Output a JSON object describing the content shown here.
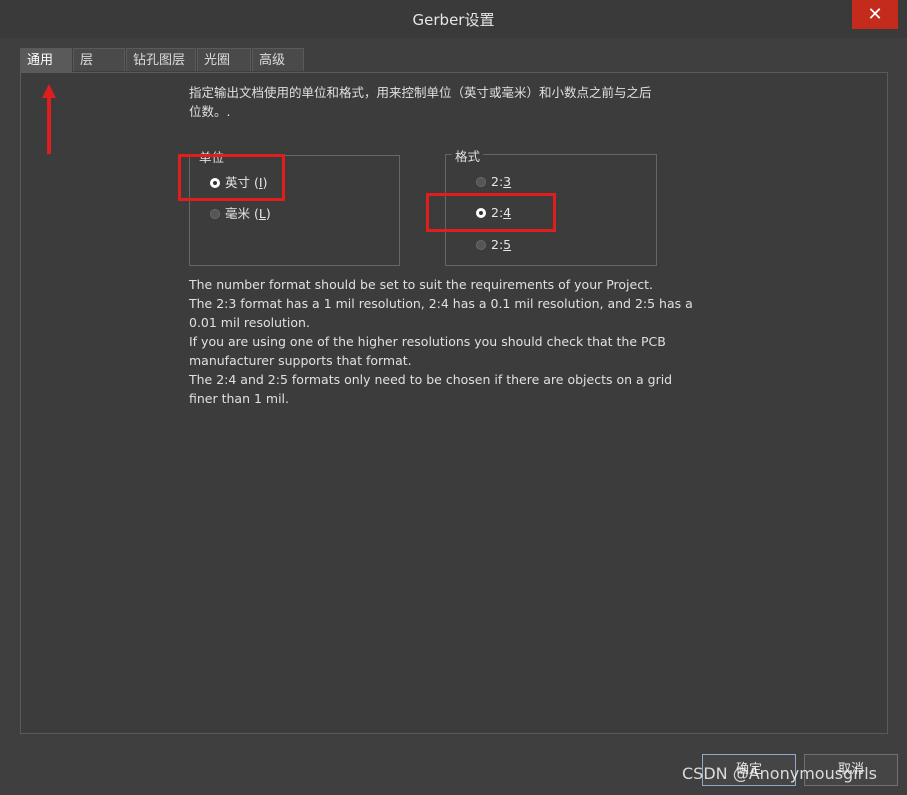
{
  "window": {
    "title": "Gerber设置",
    "close_glyph": "✕"
  },
  "tabs": [
    {
      "label": "通用",
      "active": true
    },
    {
      "label": "层",
      "active": false
    },
    {
      "label": "钻孔图层",
      "active": false
    },
    {
      "label": "光圈",
      "active": false
    },
    {
      "label": "高级",
      "active": false
    }
  ],
  "description_lines": [
    "指定输出文档使用的单位和格式，用来控制单位（英寸或毫米）和小数点之前与之后",
    "位数。."
  ],
  "units_group": {
    "label": "单位",
    "options": [
      {
        "label": "英寸",
        "hotkey": "I",
        "checked": true
      },
      {
        "label": "毫米",
        "hotkey": "L",
        "checked": false
      }
    ]
  },
  "format_group": {
    "label": "格式",
    "options": [
      {
        "prefix": "2:",
        "hotkey": "3",
        "checked": false
      },
      {
        "prefix": "2:",
        "hotkey": "4",
        "checked": true
      },
      {
        "prefix": "2:",
        "hotkey": "5",
        "checked": false
      }
    ]
  },
  "info_lines": [
    "The number format should be set to suit the requirements of your Project.",
    "The 2:3 format has a 1 mil resolution, 2:4 has a 0.1 mil resolution, and 2:5 has a",
    "0.01 mil resolution.",
    "If you are using one of the higher resolutions you should check that the PCB",
    "manufacturer supports that format.",
    "The 2:4 and 2:5 formats only need to be chosen if there are objects on a grid",
    "finer than 1 mil."
  ],
  "buttons": {
    "ok": "确定",
    "cancel": "取消"
  },
  "watermark": "CSDN @Anonymousgirls",
  "colors": {
    "highlight": "#e01e1e",
    "close": "#c42b1c"
  }
}
